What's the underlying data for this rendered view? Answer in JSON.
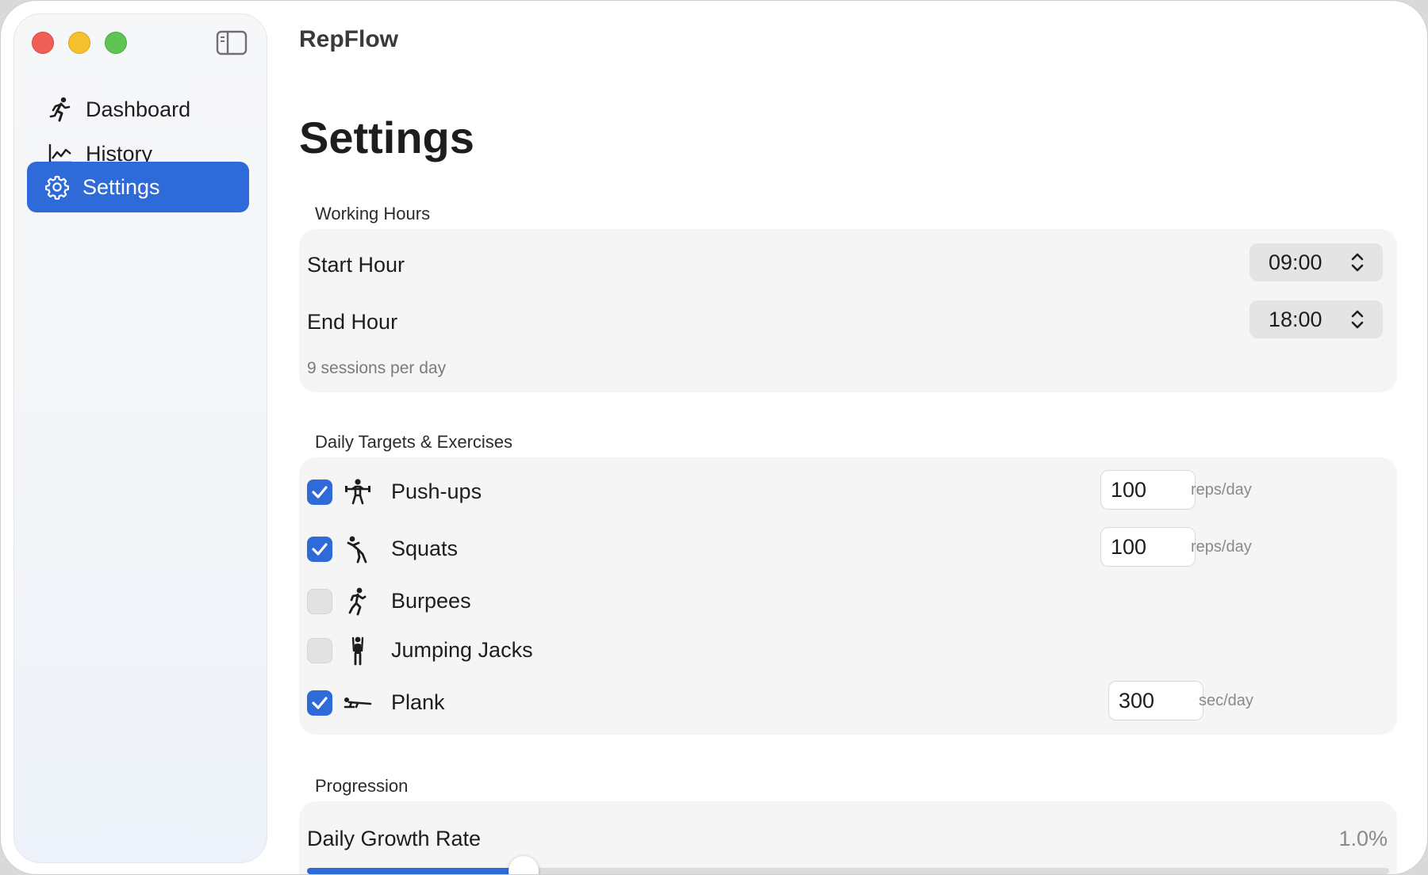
{
  "app": {
    "title": "RepFlow"
  },
  "sidebar": {
    "items": [
      {
        "label": "Dashboard",
        "icon": "running-figure-icon"
      },
      {
        "label": "History",
        "icon": "line-chart-icon"
      },
      {
        "label": "Settings",
        "icon": "gear-icon",
        "active": true
      }
    ]
  },
  "page": {
    "title": "Settings"
  },
  "working_hours": {
    "section": "Working Hours",
    "start_label": "Start Hour",
    "start_value": "09:00",
    "end_label": "End Hour",
    "end_value": "18:00",
    "hint": "9 sessions per day"
  },
  "targets": {
    "section": "Daily Targets & Exercises",
    "exercises": [
      {
        "name": "Push-ups",
        "checked": true,
        "value": "100",
        "unit": "reps/day",
        "icon": "pushup-figure-icon"
      },
      {
        "name": "Squats",
        "checked": true,
        "value": "100",
        "unit": "reps/day",
        "icon": "squat-figure-icon"
      },
      {
        "name": "Burpees",
        "checked": false,
        "icon": "burpee-figure-icon"
      },
      {
        "name": "Jumping Jacks",
        "checked": false,
        "icon": "jumping-jacks-figure-icon"
      },
      {
        "name": "Plank",
        "checked": true,
        "value": "300",
        "unit": "sec/day",
        "icon": "plank-figure-icon"
      }
    ]
  },
  "progression": {
    "section": "Progression",
    "rate_label": "Daily Growth Rate",
    "rate_value": "1.0%",
    "slider_fraction": 0.2
  },
  "colors": {
    "accent": "#2f6ad9"
  }
}
